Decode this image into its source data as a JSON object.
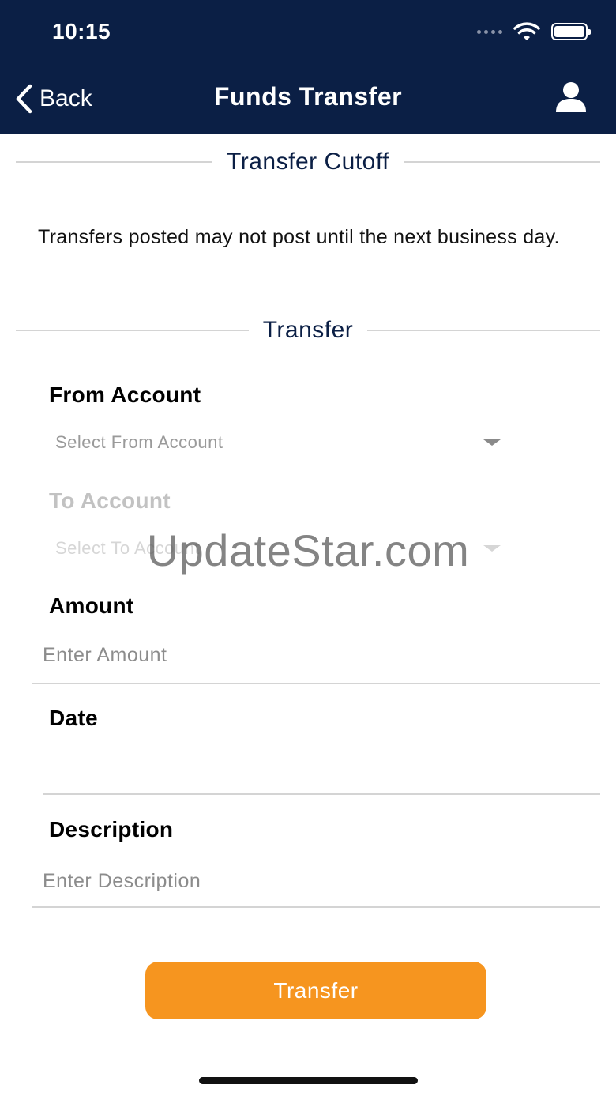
{
  "status_bar": {
    "time": "10:15"
  },
  "nav": {
    "back_label": "Back",
    "title": "Funds Transfer"
  },
  "cutoff_section": {
    "title": "Transfer Cutoff",
    "notice": "Transfers posted may not post until the next business day."
  },
  "transfer_section": {
    "title": "Transfer"
  },
  "form": {
    "from_account": {
      "label": "From Account",
      "placeholder": "Select From Account"
    },
    "to_account": {
      "label": "To Account",
      "placeholder": "Select To Account"
    },
    "amount": {
      "label": "Amount",
      "placeholder": "Enter Amount"
    },
    "date": {
      "label": "Date",
      "value": ""
    },
    "description": {
      "label": "Description",
      "placeholder": "Enter Description"
    },
    "submit_label": "Transfer"
  },
  "watermark": "UpdateStar.com",
  "colors": {
    "header_bg": "#0b1f45",
    "accent": "#f6951f",
    "section_title": "#0b1f45"
  },
  "icons": {
    "back": "chevron-left-icon",
    "profile": "user-icon",
    "wifi": "wifi-icon",
    "battery": "battery-icon",
    "signal": "signal-icon",
    "dropdown": "caret-down-icon"
  }
}
